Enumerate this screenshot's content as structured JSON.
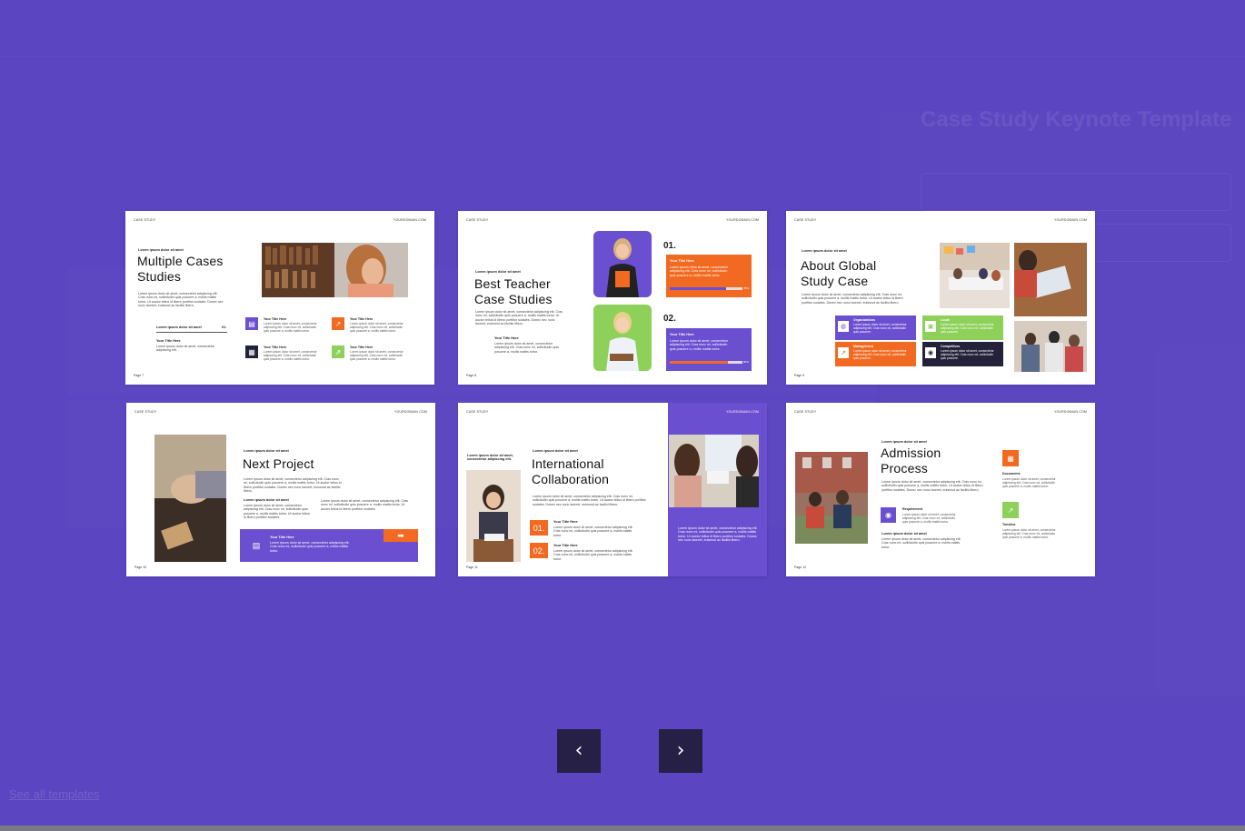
{
  "colors": {
    "purple": "#6a4fd0",
    "orange": "#f26a21",
    "green": "#8dd15a",
    "dark": "#24223a",
    "overlay": "#5b45c0"
  },
  "background": {
    "product_title": "Case Study Keynote Template",
    "link_text": "See all templates"
  },
  "slides": [
    {
      "label_left": "CASE STUDY",
      "label_right": "YOURDOMAIN.COM",
      "kicker": "Lorem ipsum dolor sit amet",
      "title_line1": "Multiple Cases",
      "title_line2": "Studies",
      "body": "Lorem ipsum dolor sit amet, consectetur adipiscing elit. Cras nunc mi, sollicitudin quis posuere a, mollis mattis tortor. Ut auctor tellus id libero porttitor sodales. Donec nec nunc laoreet, euismod ac facilisi libero.",
      "row_label": "Lorem ipsum dolor sit amet",
      "row_num": "01.",
      "sub_title": "Your Title Here",
      "sub_body": "Lorem ipsum dolor sit amet, consectetur adipiscing elit.",
      "items": [
        {
          "title": "Your Title Here",
          "body": "Lorem ipsum dolor sit amet, consectetur adipiscing elit. Cras nunc mi, sollicitudin quis posuere a, mollis mattis tortor."
        },
        {
          "title": "Your Title Here",
          "body": "Lorem ipsum dolor sit amet, consectetur adipiscing elit. Cras nunc mi, sollicitudin quis posuere a, mollis mattis tortor."
        },
        {
          "title": "Your Title Here",
          "body": "Lorem ipsum dolor sit amet, consectetur adipiscing elit. Cras nunc mi, sollicitudin quis posuere a, mollis mattis tortor."
        },
        {
          "title": "Your Title Here",
          "body": "Lorem ipsum dolor sit amet, consectetur adipiscing elit. Cras nunc mi, sollicitudin quis posuere a, mollis mattis tortor."
        }
      ],
      "page": "Page 7"
    },
    {
      "label_left": "CASE STUDY",
      "label_right": "YOURDOMAIN.COM",
      "kicker": "Lorem ipsum dolor sit amet",
      "title_line1": "Best Teacher",
      "title_line2": "Case Studies",
      "body": "Lorem ipsum dolor sit amet, consectetur adipiscing elit. Cras nunc mi, sollicitudin quis posuere a, mollis mattis tortor. Ut auctor tellus id libero porttitor sodales. Donec nec nunc laoreet, euismod ac facilisi libero.",
      "sub_title": "Your Title Here",
      "sub_body": "Lorem ipsum dolor sit amet, consectetur adipiscing elit. Cras nunc mi, sollicitudin quis posuere a, mollis mattis tortor.",
      "num1": "01.",
      "num2": "02.",
      "box_title": "Your Title Here",
      "box_body": "Lorem ipsum dolor sit amet, consectetur adipiscing elit. Cras nunc mi, sollicitudin quis posuere a, mollis mattis tortor.",
      "bar1_pct": "78%",
      "bar2_pct": "80%",
      "bar1_level": 0.78,
      "bar2_level": 0.8,
      "page": "Page 8"
    },
    {
      "label_left": "CASE STUDY",
      "label_right": "YOURDOMAIN.COM",
      "kicker": "Lorem ipsum dolor sit amet",
      "title_line1": "About Global",
      "title_line2": "Study Case",
      "body": "Lorem ipsum dolor sit amet, consectetur adipiscing elit. Cras nunc mi, sollicitudin quis posuere a, mollis mattis tortor. Ut auctor tellus id libero porttitor sodales. Donec nec nunc laoreet, euismod ac facilisi libero.",
      "cells": [
        {
          "title": "Organizations",
          "body": "Lorem ipsum dolor sit amet, consectetur adipiscing elit. Cras nunc mi, sollicitudin quis posuere."
        },
        {
          "title": "Locat",
          "body": "Lorem ipsum dolor sit amet, consectetur adipiscing elit. Cras nunc mi, sollicitudin quis posuere."
        },
        {
          "title": "Management",
          "body": "Lorem ipsum dolor sit amet, consectetur adipiscing elit. Cras nunc mi, sollicitudin quis posuere."
        },
        {
          "title": "Competitors",
          "body": "Lorem ipsum dolor sit amet, consectetur adipiscing elit. Cras nunc mi, sollicitudin quis posuere."
        }
      ],
      "page": "Page 9"
    },
    {
      "label_left": "CASE STUDY",
      "label_right": "YOURDOMAIN.COM",
      "kicker": "Lorem ipsum dolor sit amet",
      "title_line1": "Next Project",
      "body": "Lorem ipsum dolor sit amet, consectetur adipiscing elit. Cras nunc mi, sollicitudin quis posuere a, mollis mattis tortor. Ut auctor tellus id libero porttitor sodales. Donec nec nunc laoreet, euismod ac facilisi libero.",
      "col1_title": "Lorem ipsum dolor sit amet",
      "col1_body": "Lorem ipsum dolor sit amet, consectetur adipiscing elit. Cras nunc mi, sollicitudin quis posuere a, mollis mattis tortor. Ut auctor tellus id libero porttitor sodales.",
      "col2_body": "Lorem ipsum dolor sit amet, consectetur adipiscing elit. Cras nunc mi, sollicitudin quis posuere a, mollis mattis tortor. Ut auctor tellus id libero porttitor sodales.",
      "band_title": "Your Title Here",
      "band_body": "Lorem ipsum dolor sit amet, consectetur adipiscing elit. Cras nunc mi, sollicitudin quis posuere a, mollis mattis tortor.",
      "page": "Page 10"
    },
    {
      "label_left": "CASE STUDY",
      "label_right": "YOURDOMAIN.COM",
      "kicker": "Lorem ipsum dolor sit amet",
      "side_kicker": "Lorem ipsum dolor sit amet, consectetur adipiscing elit.",
      "title_line1": "International",
      "title_line2": "Collaboration",
      "body": "Lorem ipsum dolor sit amet, consectetur adipiscing elit. Cras nunc mi, sollicitudin quis posuere a, mollis mattis tortor. Ut auctor tellus id libero porttitor sodales. Donec nec nunc laoreet, euismod ac facilisi libero.",
      "num1": "01.",
      "num2": "02.",
      "item_title": "Your Title Here",
      "item_body": "Lorem ipsum dolor sit amet, consectetur adipiscing elit. Cras nunc mi, sollicitudin quis posuere a, mollis mattis tortor.",
      "panel_body": "Lorem ipsum dolor sit amet, consectetur adipiscing elit. Cras nunc mi, sollicitudin quis posuere a, mollis mattis tortor. Ut auctor tellus id libero porttitor sodales. Donec nec nunc laoreet, euismod ac facilisi libero.",
      "page": "Page 11"
    },
    {
      "label_left": "CASE STUDY",
      "label_right": "YOURDOMAIN.COM",
      "kicker": "Lorem ipsum dolor sit amet",
      "title_line1": "Admission",
      "title_line2": "Process",
      "body": "Lorem ipsum dolor sit amet, consectetur adipiscing elit. Cras nunc mi, sollicitudin quis posuere a, mollis mattis tortor. Ut auctor tellus id libero porttitor sodales. Donec nec nunc laoreet, euismod ac facilisi libero.",
      "req_title": "Requirement",
      "req_body": "Lorem ipsum dolor sit amet, consectetur adipiscing elit. Cras nunc mi, sollicitudin quis posuere a, mollis mattis tortor.",
      "bottom_title": "Lorem ipsum dolor sit amet",
      "bottom_body": "Lorem ipsum dolor sit amet, consectetur adipiscing elit. Cras nunc mi, sollicitudin quis posuere a, mollis mattis tortor.",
      "doc_title": "Documents",
      "doc_body": "Lorem ipsum dolor sit amet, consectetur adipiscing elit. Cras nunc mi, sollicitudin quis posuere a, mollis mattis tortor.",
      "tl_title": "Timeline",
      "tl_body": "Lorem ipsum dolor sit amet, consectetur adipiscing elit. Cras nunc mi, sollicitudin quis posuere a, mollis mattis tortor.",
      "page": "Page 12"
    }
  ],
  "nav": {
    "prev_icon": "chevron-left-icon",
    "next_icon": "chevron-right-icon",
    "prev_glyph": "‹",
    "next_glyph": "›"
  }
}
